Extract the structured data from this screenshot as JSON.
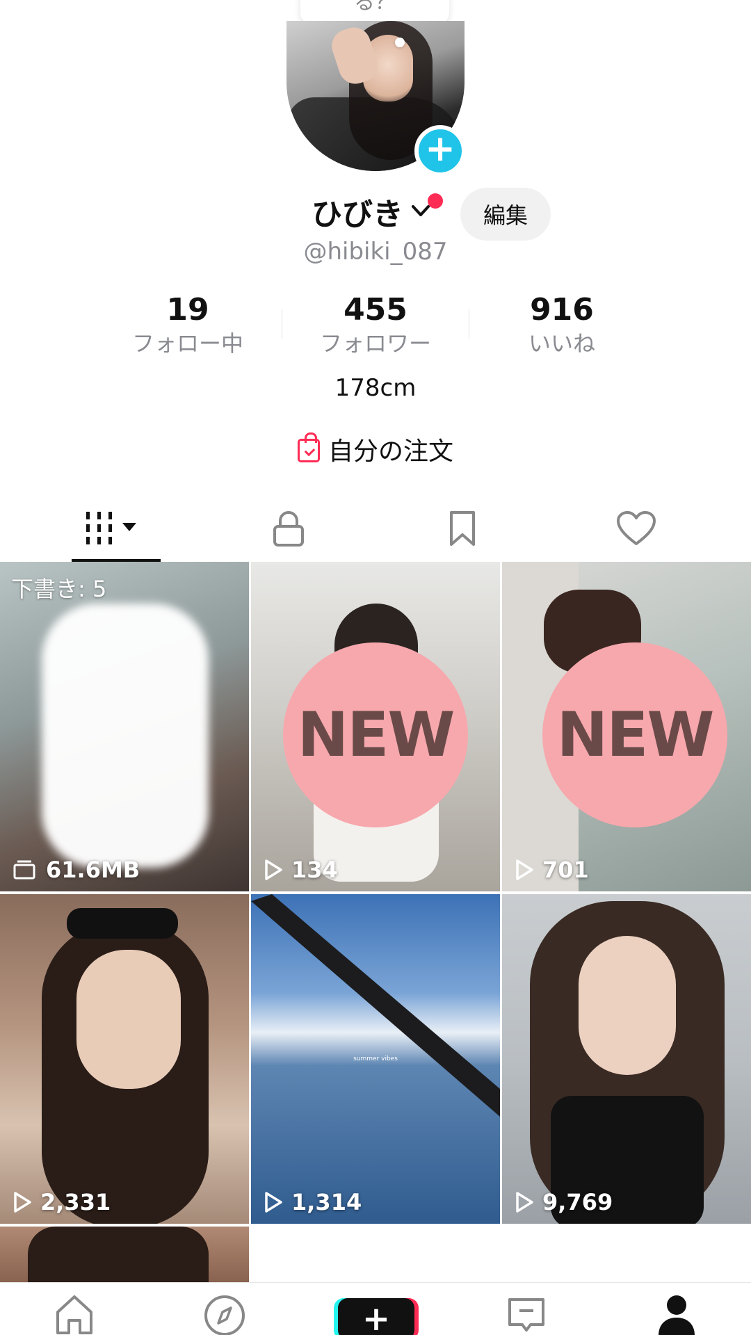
{
  "tooltip": {
    "text": "る？"
  },
  "profile": {
    "display_name": "ひびき",
    "handle": "@hibiki_087",
    "edit_label": "編集",
    "bio": "178cm",
    "orders_label": "自分の注文"
  },
  "stats": [
    {
      "value": "19",
      "label": "フォロー中"
    },
    {
      "value": "455",
      "label": "フォロワー"
    },
    {
      "value": "916",
      "label": "いいね"
    }
  ],
  "tabs": [
    {
      "icon": "grid-videos-icon",
      "active": true
    },
    {
      "icon": "lock-icon",
      "active": false
    },
    {
      "icon": "bookmark-icon",
      "active": false
    },
    {
      "icon": "heart-icon",
      "active": false
    }
  ],
  "videos": [
    {
      "type": "draft",
      "draft_label": "下書き: 5",
      "size": "61.6MB"
    },
    {
      "type": "new",
      "badge": "NEW",
      "views": "134"
    },
    {
      "type": "new",
      "badge": "NEW",
      "views": "701"
    },
    {
      "type": "video",
      "views": "2,331"
    },
    {
      "type": "video",
      "views": "1,314",
      "caption": "summer vibes"
    },
    {
      "type": "video",
      "views": "9,769"
    }
  ],
  "bottom_nav": [
    {
      "icon": "home-icon"
    },
    {
      "icon": "discover-compass-icon"
    },
    {
      "icon": "create-plus-icon",
      "label": "+"
    },
    {
      "icon": "inbox-icon"
    },
    {
      "icon": "profile-icon"
    }
  ],
  "colors": {
    "accent_pink": "#fe2c55",
    "accent_cyan": "#20c4e8",
    "new_badge": "#f7a8ad"
  }
}
